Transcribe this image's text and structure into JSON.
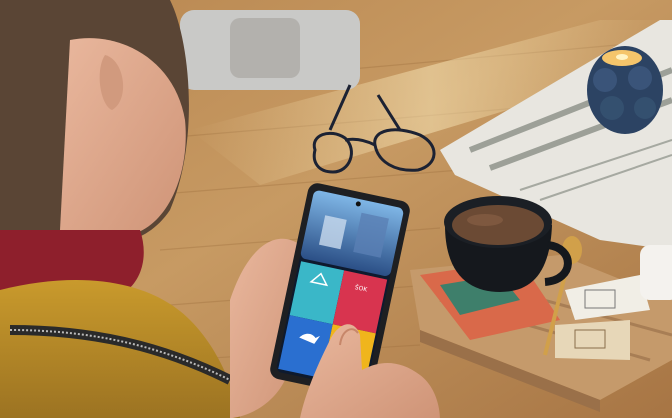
{
  "phone": {
    "tile_top_right_label": "ŠOK",
    "colors": {
      "tile_teal": "#3ab7c8",
      "tile_red": "#d8344f",
      "tile_blue": "#2a6fd0",
      "tile_yellow": "#f0b51c"
    }
  }
}
